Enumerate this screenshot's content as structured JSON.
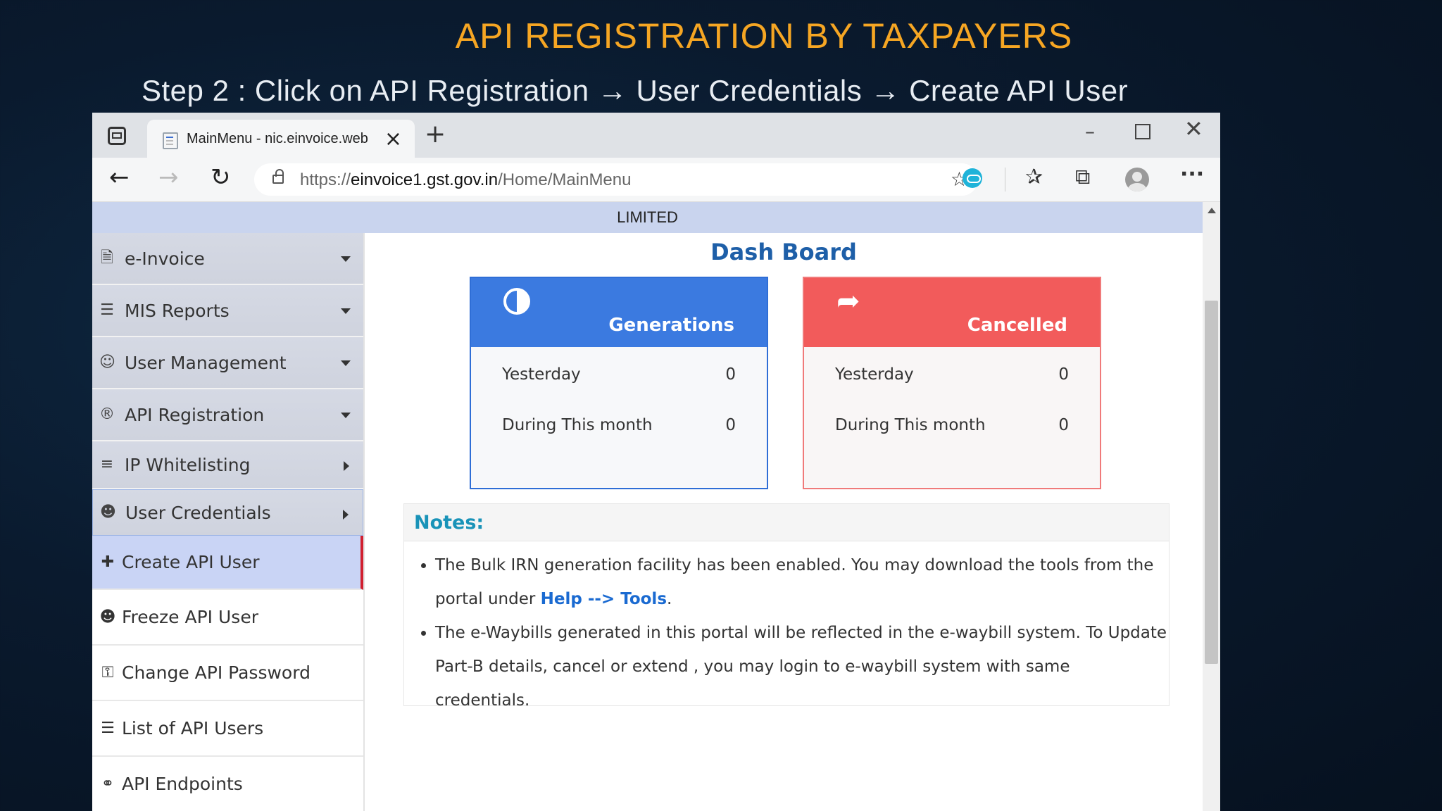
{
  "slide": {
    "title": "API REGISTRATION BY TAXPAYERS",
    "step": "Step 2 : Click on API Registration → User Credentials → Create API User"
  },
  "browser": {
    "tab_title": "MainMenu - nic.einvoice.web",
    "tab_close": "×",
    "new_tab": "+",
    "url_prefix": "https://",
    "url_host": "einvoice1.gst.gov.in",
    "url_path": "/Home/MainMenu",
    "icons": [
      "tab-actions-icon",
      "back-icon",
      "forward-icon",
      "refresh-icon",
      "lock-icon",
      "add-favorite-icon",
      "extension-icon",
      "favorites-icon",
      "collections-icon",
      "profile-icon",
      "more-icon"
    ],
    "glyphs": {
      "back": "←",
      "forward": "→",
      "refresh": "↻",
      "fav_add": "☆",
      "favorites": "✰",
      "collections": "⧉",
      "more": "···",
      "min": "–",
      "close": "✕"
    }
  },
  "page": {
    "org_band": "LIMITED"
  },
  "sidebar": {
    "items": [
      {
        "label": "e-Invoice",
        "icon": "document-icon",
        "glyph": "🗎",
        "caret": "down"
      },
      {
        "label": "MIS Reports",
        "icon": "list-icon",
        "glyph": "☰",
        "caret": "down"
      },
      {
        "label": "User Management",
        "icon": "users-icon",
        "glyph": "☺",
        "caret": "down"
      },
      {
        "label": "API Registration",
        "icon": "registered-icon",
        "glyph": "®",
        "caret": "down"
      },
      {
        "label": "IP Whitelisting",
        "icon": "server-icon",
        "glyph": "≡",
        "caret": "right"
      },
      {
        "label": "User Credentials",
        "icon": "user-lock-icon",
        "glyph": "☻",
        "caret": "right"
      }
    ],
    "sub_items": [
      {
        "label": "Create API User",
        "icon": "user-plus-icon",
        "glyph": "✚"
      },
      {
        "label": "Freeze API User",
        "icon": "user-lock-icon",
        "glyph": "☻"
      },
      {
        "label": "Change API Password",
        "icon": "key-icon",
        "glyph": "⚿"
      },
      {
        "label": "List of API Users",
        "icon": "list-icon",
        "glyph": "☰"
      },
      {
        "label": "API Endpoints",
        "icon": "link-icon",
        "glyph": "⚭"
      }
    ]
  },
  "dashboard": {
    "title": "Dash Board",
    "generations": {
      "label": "Generations",
      "icon": "half-circle-icon",
      "rows": [
        {
          "label": "Yesterday",
          "value": "0"
        },
        {
          "label": "During This month",
          "value": "0"
        }
      ],
      "color": "#3b7ae0"
    },
    "cancelled": {
      "label": "Cancelled",
      "icon": "share-arrow-icon",
      "glyph": "➦",
      "rows": [
        {
          "label": "Yesterday",
          "value": "0"
        },
        {
          "label": "During This month",
          "value": "0"
        }
      ],
      "color": "#f25b5b"
    }
  },
  "notes": {
    "title": "Notes:",
    "item1_before": "The Bulk IRN generation facility has been enabled. You may download the tools from the portal under ",
    "item1_link": "Help --> Tools",
    "item1_after": ".",
    "item2": "The e-Waybills generated in this portal will be reflected in the e-waybill system. To Update Part-B details, cancel or extend , you may login to e-waybill system with same credentials."
  }
}
